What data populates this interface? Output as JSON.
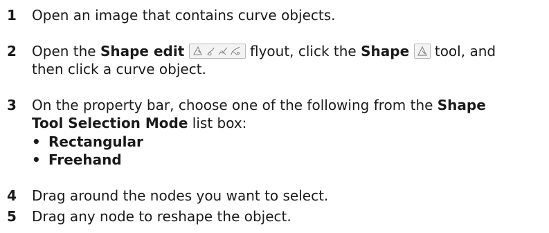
{
  "steps": [
    {
      "num": "1",
      "text": "Open an image that contains curve objects."
    },
    {
      "num": "2",
      "a": "Open the ",
      "b1": "Shape edit",
      "c": " flyout, click the ",
      "b2": "Shape",
      "d": " tool, and",
      "e": "then click a curve object."
    },
    {
      "num": "3",
      "a": "On the property bar, choose one of the following from the ",
      "b1": "Shape",
      "b2": "Tool Selection Mode",
      "c": " list box:",
      "options": [
        "Rectangular",
        "Freehand"
      ]
    },
    {
      "num": "4",
      "text": "Drag around the nodes you want to select."
    },
    {
      "num": "5",
      "text": "Drag any node to reshape the object."
    }
  ],
  "bullet": "•",
  "icons": {
    "flyout": [
      "shape-icon",
      "smudge-icon",
      "roughen-icon",
      "transform-icon"
    ],
    "tool": "shape-icon"
  }
}
